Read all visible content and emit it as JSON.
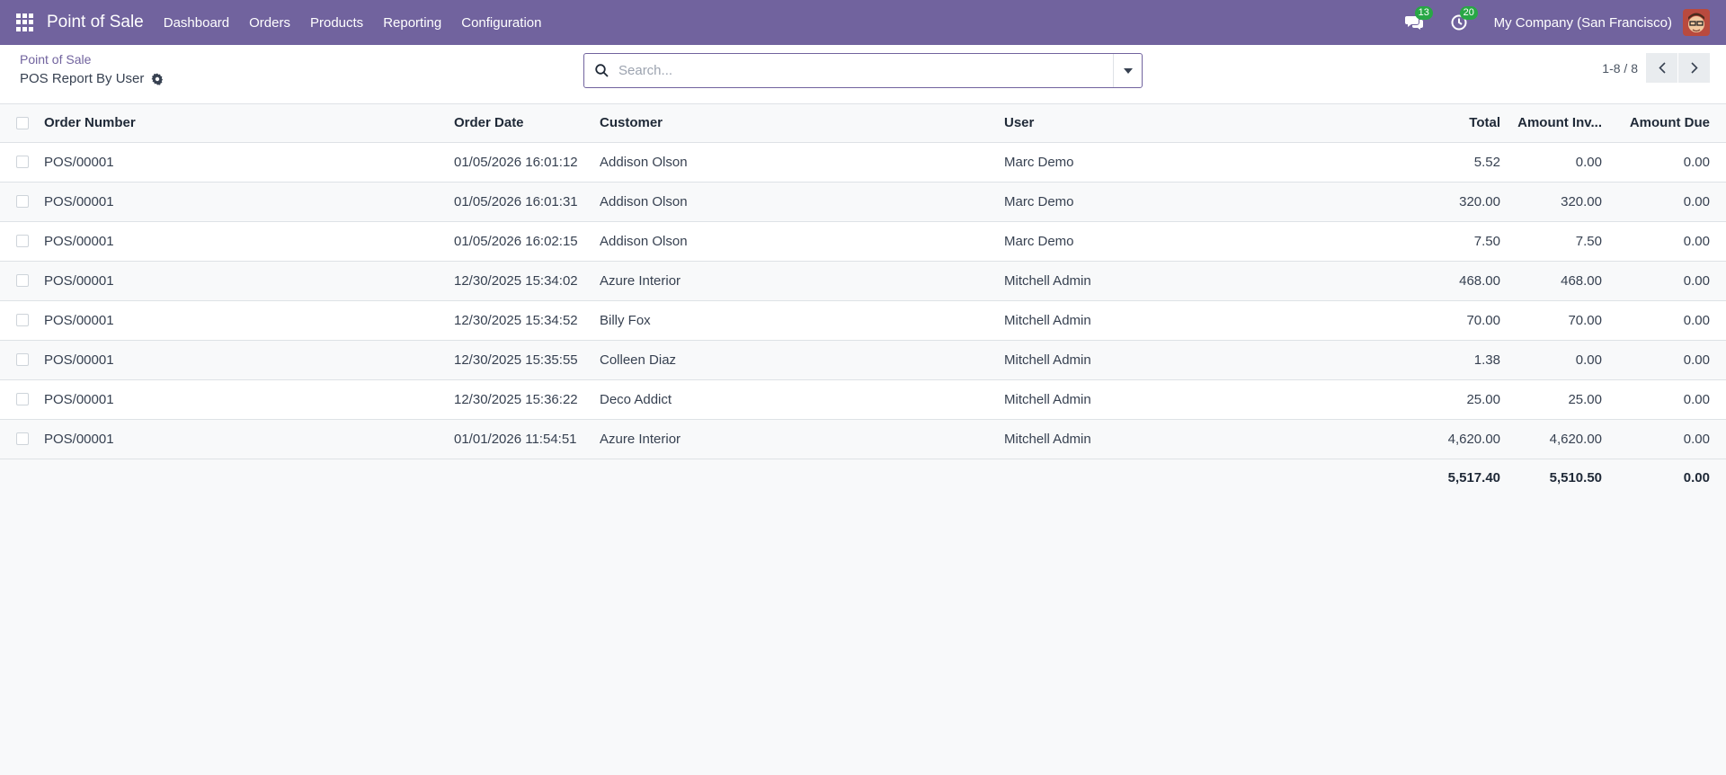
{
  "navbar": {
    "brand": "Point of Sale",
    "menu": [
      "Dashboard",
      "Orders",
      "Products",
      "Reporting",
      "Configuration"
    ],
    "messages_count": "13",
    "activities_count": "20",
    "company": "My Company (San Francisco)"
  },
  "control_panel": {
    "breadcrumb": "Point of Sale",
    "title": "POS Report By User",
    "search_placeholder": "Search...",
    "pager": "1-8 / 8"
  },
  "table": {
    "columns": {
      "order_number": "Order Number",
      "order_date": "Order Date",
      "customer": "Customer",
      "user": "User",
      "total": "Total",
      "amount_invoiced": "Amount Inv...",
      "amount_due": "Amount Due"
    },
    "rows": [
      {
        "order": "POS/00001",
        "date": "01/05/2026 16:01:12",
        "customer": "Addison Olson",
        "user": "Marc Demo",
        "total": "5.52",
        "invoiced": "0.00",
        "due": "0.00"
      },
      {
        "order": "POS/00001",
        "date": "01/05/2026 16:01:31",
        "customer": "Addison Olson",
        "user": "Marc Demo",
        "total": "320.00",
        "invoiced": "320.00",
        "due": "0.00"
      },
      {
        "order": "POS/00001",
        "date": "01/05/2026 16:02:15",
        "customer": "Addison Olson",
        "user": "Marc Demo",
        "total": "7.50",
        "invoiced": "7.50",
        "due": "0.00"
      },
      {
        "order": "POS/00001",
        "date": "12/30/2025 15:34:02",
        "customer": "Azure Interior",
        "user": "Mitchell Admin",
        "total": "468.00",
        "invoiced": "468.00",
        "due": "0.00"
      },
      {
        "order": "POS/00001",
        "date": "12/30/2025 15:34:52",
        "customer": "Billy Fox",
        "user": "Mitchell Admin",
        "total": "70.00",
        "invoiced": "70.00",
        "due": "0.00"
      },
      {
        "order": "POS/00001",
        "date": "12/30/2025 15:35:55",
        "customer": "Colleen Diaz",
        "user": "Mitchell Admin",
        "total": "1.38",
        "invoiced": "0.00",
        "due": "0.00"
      },
      {
        "order": "POS/00001",
        "date": "12/30/2025 15:36:22",
        "customer": "Deco Addict",
        "user": "Mitchell Admin",
        "total": "25.00",
        "invoiced": "25.00",
        "due": "0.00"
      },
      {
        "order": "POS/00001",
        "date": "01/01/2026 11:54:51",
        "customer": "Azure Interior",
        "user": "Mitchell Admin",
        "total": "4,620.00",
        "invoiced": "4,620.00",
        "due": "0.00"
      }
    ],
    "totals": {
      "total": "5,517.40",
      "invoiced": "5,510.50",
      "due": "0.00"
    }
  },
  "colors": {
    "brand": "#71639e",
    "badge": "#28a745"
  }
}
